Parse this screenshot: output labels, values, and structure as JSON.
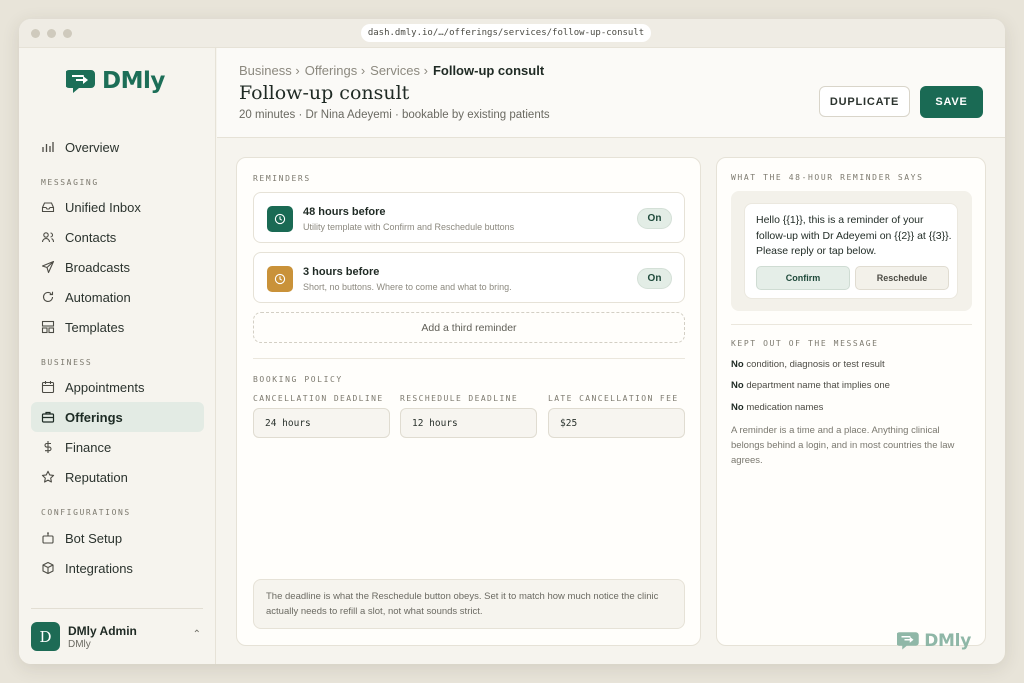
{
  "browser": {
    "url": "dash.dmly.io/…/offerings/services/follow-up-consult"
  },
  "brand": {
    "name": "DMly",
    "color": "#1c6e57"
  },
  "sidebar": {
    "overview": "Overview",
    "sections": {
      "messaging": "MESSAGING",
      "business": "BUSINESS",
      "configurations": "CONFIGURATIONS"
    },
    "items": {
      "unified_inbox": "Unified Inbox",
      "contacts": "Contacts",
      "broadcasts": "Broadcasts",
      "automation": "Automation",
      "templates": "Templates",
      "appointments": "Appointments",
      "offerings": "Offerings",
      "finance": "Finance",
      "reputation": "Reputation",
      "bot_setup": "Bot Setup",
      "integrations": "Integrations"
    },
    "active": "Offerings",
    "user": {
      "initial": "D",
      "name": "DMly Admin",
      "org": "DMly"
    }
  },
  "header": {
    "breadcrumb": [
      "Business ›",
      "Offerings ›",
      "Services ›",
      "Follow-up consult"
    ],
    "title": "Follow-up consult",
    "subtitle": "20 minutes · Dr Nina Adeyemi · bookable by existing patients",
    "duplicate_label": "DUPLICATE",
    "save_label": "SAVE"
  },
  "reminders": {
    "section_label": "REMINDERS",
    "items": [
      {
        "title": "48 hours before",
        "desc": "Utility template with Confirm and Reschedule buttons",
        "state": "On",
        "icon_color": "#1a6a54"
      },
      {
        "title": "3 hours before",
        "desc": "Short, no buttons. Where to come and what to bring.",
        "state": "On",
        "icon_color": "#c9923a"
      }
    ],
    "add_label": "Add a third reminder"
  },
  "policy": {
    "section_label": "BOOKING POLICY",
    "fields": [
      {
        "label": "CANCELLATION DEADLINE",
        "value": "24 hours"
      },
      {
        "label": "RESCHEDULE DEADLINE",
        "value": "12 hours"
      },
      {
        "label": "LATE CANCELLATION FEE",
        "value": "$25"
      }
    ],
    "note": "The deadline is what the Reschedule button obeys. Set it to match how much notice the clinic actually needs to refill a slot, not what sounds strict."
  },
  "preview": {
    "section_label": "WHAT THE 48-HOUR REMINDER SAYS",
    "message": "Hello {{1}}, this is a reminder of your follow-up with Dr Adeyemi on {{2}} at {{3}}. Please reply or tap below.",
    "confirm_label": "Confirm",
    "reschedule_label": "Reschedule",
    "kept_out_label": "KEPT OUT OF THE MESSAGE",
    "rules": [
      {
        "prefix": "No",
        "text": "condition, diagnosis or test result"
      },
      {
        "prefix": "No",
        "text": "department name that implies one"
      },
      {
        "prefix": "No",
        "text": "medication names"
      }
    ],
    "explanation": "A reminder is a time and a place. Anything clinical belongs behind a login, and in most countries the law agrees."
  }
}
